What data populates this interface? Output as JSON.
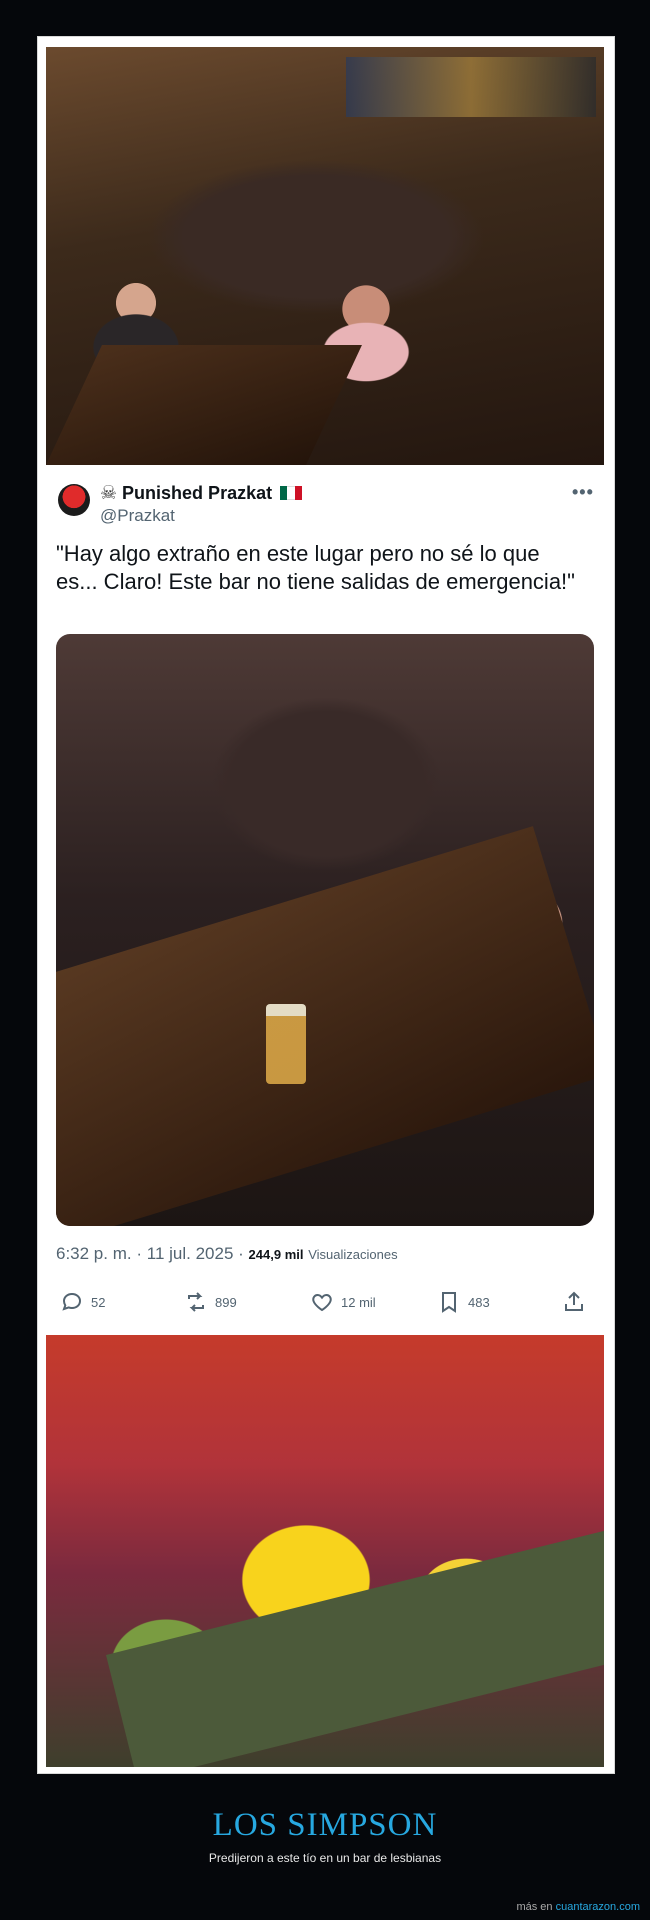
{
  "tweet": {
    "display_name": "Punished Prazkat",
    "handle": "@Prazkat",
    "text": "\"Hay algo extraño en este lugar pero no sé lo que es... Claro! Este bar no tiene salidas de emergencia!\"",
    "time": "6:32 p. m.",
    "date": "11 jul. 2025",
    "views_count": "244,9 mil",
    "views_label": "Visualizaciones",
    "separator": "·",
    "actions": {
      "replies": "52",
      "retweets": "899",
      "likes": "12 mil",
      "bookmarks": "483"
    }
  },
  "meme": {
    "title": "LOS SIMPSON",
    "subtitle": "Predijeron a este tío en un bar de lesbianas"
  },
  "footer": {
    "prefix": "más en",
    "site": "cuantarazon.com"
  },
  "colors": {
    "accent": "#27a8e0",
    "page_bg": "#05070b",
    "card_bg": "#ffffff"
  },
  "icons": [
    "skull-icon",
    "mexico-flag-icon",
    "more-icon",
    "reply-icon",
    "retweet-icon",
    "like-icon",
    "bookmark-icon",
    "share-icon"
  ]
}
